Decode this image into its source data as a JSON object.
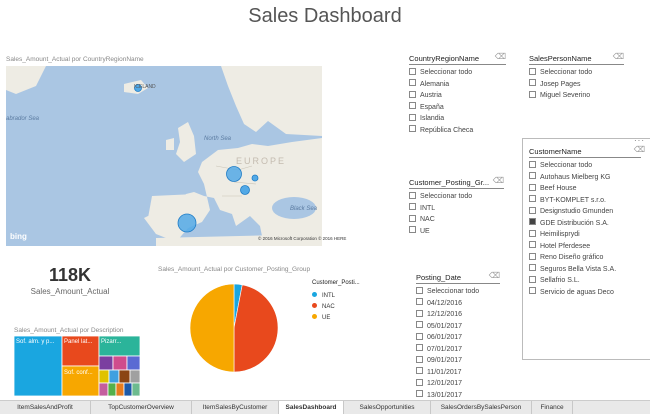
{
  "title": "Sales Dashboard",
  "map": {
    "title": "Sales_Amount_Actual por CountryRegionName",
    "labels": {
      "iceland": "ICELAND",
      "north_sea": "North Sea",
      "labrador_sea": "abrador Sea",
      "black_sea": "Black Sea",
      "europe": "EUROPE"
    },
    "bing": "bing",
    "copyright": "© 2016 Microsoft Corporation   © 2016 HERE"
  },
  "kpi": {
    "value": "118K",
    "label": "Sales_Amount_Actual"
  },
  "treemap": {
    "title": "Sales_Amount_Actual por Description",
    "labels": [
      "Sof. alm. y p...",
      "Panel lat...",
      "Pizarr...",
      "Sof. conf..."
    ]
  },
  "pie": {
    "title": "Sales_Amount_Actual por Customer_Posting_Group",
    "legend_title": "Customer_Posti...",
    "colors": {
      "INTL": "#1aa6e0",
      "NAC": "#e8491d",
      "UE": "#f7a700"
    }
  },
  "chart_data": {
    "type": "pie",
    "categories": [
      "INTL",
      "NAC",
      "UE"
    ],
    "values": [
      3,
      47,
      50
    ],
    "title": "Sales_Amount_Actual por Customer_Posting_Group"
  },
  "slicers": {
    "country": {
      "title": "CountryRegionName",
      "items": [
        "Seleccionar todo",
        "Alemania",
        "Austria",
        "España",
        "Islandia",
        "República Checa"
      ]
    },
    "salesperson": {
      "title": "SalesPersonName",
      "items": [
        "Seleccionar todo",
        "Josep Pages",
        "Miguel Severino"
      ]
    },
    "posting_group": {
      "title": "Customer_Posting_Gr...",
      "items": [
        "Seleccionar todo",
        "INTL",
        "NAC",
        "UE"
      ]
    },
    "customer": {
      "title": "CustomerName",
      "items": [
        "Seleccionar todo",
        "Autohaus Mielberg KG",
        "Beef House",
        "BYT-KOMPLET s.r.o.",
        "Designstudio Gmunden",
        "GDE Distribución S.A.",
        "Heimilisprydi",
        "Hotel Pferdesee",
        "Reno Diseño gráfico",
        "Seguros Bella Vista S.A.",
        "Sellafrio S.L.",
        "Servicio de aguas Deco"
      ],
      "checked_index": 5
    },
    "posting_date": {
      "title": "Posting_Date",
      "items": [
        "Seleccionar todo",
        "04/12/2016",
        "12/12/2016",
        "05/01/2017",
        "06/01/2017",
        "07/01/2017",
        "09/01/2017",
        "11/01/2017",
        "12/01/2017",
        "13/01/2017"
      ]
    }
  },
  "tabs": [
    {
      "label": "ItemSalesAndProfit"
    },
    {
      "label": "TopCustomerOverview"
    },
    {
      "label": "ItemSalesByCustomer"
    },
    {
      "label": "SalesDashboard",
      "active": true
    },
    {
      "label": "SalesOpportunities"
    },
    {
      "label": "SalesOrdersBySalesPerson"
    },
    {
      "label": "Finance"
    }
  ]
}
